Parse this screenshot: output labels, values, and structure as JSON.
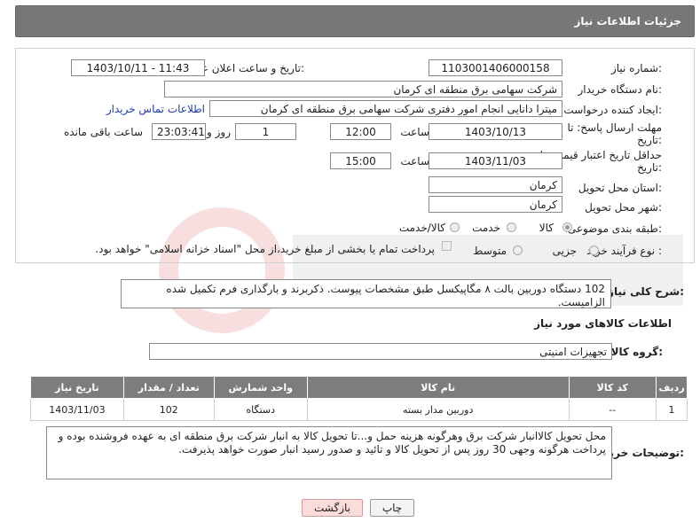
{
  "header": {
    "title": "جزئیات اطلاعات نیاز"
  },
  "form": {
    "need_number_label": "شماره نیاز:",
    "need_number": "1103001406000158",
    "announce_label": "تاریخ و ساعت اعلان عمومی:",
    "announce_value": "1403/10/11 - 11:43",
    "buyer_org_label": "نام دستگاه خریدار:",
    "buyer_org": "شرکت سهامی برق منطقه ای کرمان",
    "creator_label": "ایجاد کننده درخواست:",
    "creator": "میترا دانایی انجام امور دفتری شرکت سهامی برق منطقه ای کرمان",
    "contact_link": "اطلاعات تماس خریدار",
    "deadline_label_1": "مهلت ارسال پاسخ: تا",
    "deadline_label_2": "تاریخ:",
    "deadline_date": "1403/10/13",
    "time_label": "ساعت",
    "deadline_time": "12:00",
    "days_value": "1",
    "days_label": "روز و",
    "remaining_time": "23:03:41",
    "remaining_label": "ساعت باقی مانده",
    "validity_label_1": "حداقل تاریخ اعتبار قیمت: تا",
    "validity_label_2": "تاریخ:",
    "validity_date": "1403/11/03",
    "validity_time": "15:00",
    "province_label": "استان محل تحویل:",
    "province": "کرمان",
    "city_label": "شهر محل تحویل:",
    "city": "کرمان",
    "category_label": "طبقه بندی موضوعی:",
    "category_options": [
      "کالا",
      "خدمت",
      "کالا/خدمت"
    ],
    "process_label": "نوع فرآیند خرید :",
    "process_options": [
      "جزیی",
      "متوسط"
    ],
    "payment_note": "پرداخت تمام یا بخشی از مبلغ خرید،از محل \"اسناد خزانه اسلامی\" خواهد بود."
  },
  "description": {
    "label": "شرح کلی نیاز:",
    "text": "102 دستگاه دوربین بالت ۸ مگاپیکسل طبق مشخصات پیوست.  ذکربرند و بارگذاری فرم تکمیل شده الزامیست."
  },
  "goods": {
    "section_title": "اطلاعات کالاهای مورد نیاز",
    "group_label": "گروه کالا:",
    "group_value": "تجهیزات امنیتی",
    "columns": [
      "ردیف",
      "کد کالا",
      "نام کالا",
      "واحد شمارش",
      "تعداد / مقدار",
      "تاریخ نیاز"
    ],
    "rows": [
      {
        "row": "1",
        "code": "--",
        "name": "دوربین مدار بسته",
        "unit": "دستگاه",
        "qty": "102",
        "date": "1403/11/03"
      }
    ]
  },
  "buyer_notes": {
    "label": "توضیحات خریدار:",
    "text": "محل تحویل کالاانبار شرکت برق وهرگونه هزینه حمل و...تا تحویل کالا به انبار شرکت برق منطقه ای به عهده فروشنده بوده و پرداخت هرگونه وجهی 30 روز پس از تحویل کالا و تائید و صدور رسید انبار صورت خواهد پذیرفت."
  },
  "buttons": {
    "print": "چاپ",
    "back": "بازگشت"
  },
  "colors": {
    "header_bg": "#777777",
    "table_header_bg": "#7d7d7d",
    "back_button_bg": "#fbdcdc",
    "link": "#1a3fb0"
  }
}
